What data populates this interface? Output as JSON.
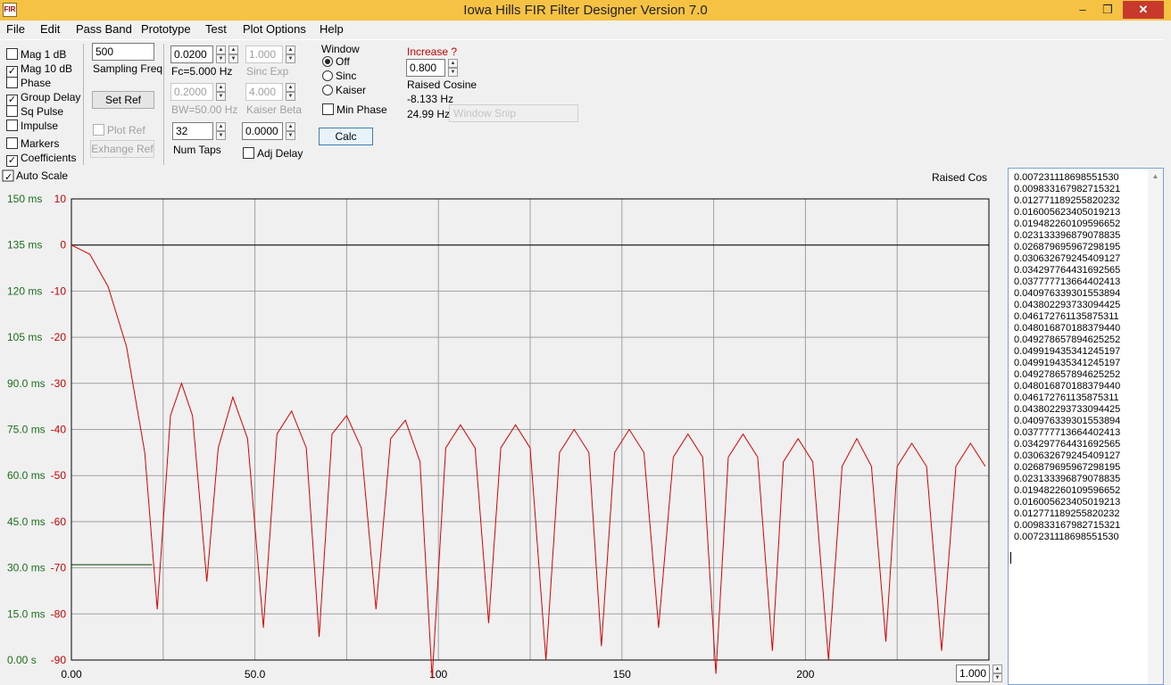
{
  "window": {
    "title": "Iowa Hills FIR Filter Designer  Version 7.0",
    "icon_text": "FIR",
    "min": "–",
    "max": "❐",
    "close": "✕"
  },
  "menu": [
    "File",
    "Edit",
    "Pass Band",
    "Prototype",
    "Test",
    "Plot Options",
    "Help"
  ],
  "plot_checks": {
    "mag1db": {
      "label": "Mag   1 dB",
      "checked": false
    },
    "mag10db": {
      "label": "Mag 10 dB",
      "checked": true
    },
    "phase": {
      "label": "Phase",
      "checked": false
    },
    "group_delay": {
      "label": "Group Delay",
      "checked": true
    },
    "sq_pulse": {
      "label": "Sq Pulse",
      "checked": false
    },
    "impulse": {
      "label": "Impulse",
      "checked": false
    },
    "markers": {
      "label": "Markers",
      "checked": false
    },
    "coefficients": {
      "label": "Coefficients",
      "checked": true
    }
  },
  "sampling": {
    "value": "500",
    "label": "Sampling Freq"
  },
  "set_ref": "Set Ref",
  "plot_ref": "Plot Ref",
  "exchange_ref": "Exhange Ref",
  "fc": {
    "value": "0.0200",
    "label": "Fc=5.000 Hz"
  },
  "bw": {
    "value": "0.2000",
    "label": "BW=50.00 Hz"
  },
  "num_taps": {
    "value": "32",
    "label": "Num Taps"
  },
  "sinc_exp": {
    "value": "1.000",
    "label": "Sinc Exp"
  },
  "kaiser_beta": {
    "value": "4.000",
    "label": "Kaiser Beta"
  },
  "adj_delay": {
    "value": "0.0000",
    "label": "Adj Delay"
  },
  "window_group": {
    "label": "Window",
    "options": [
      "Off",
      "Sinc",
      "Kaiser"
    ],
    "selected": "Off"
  },
  "min_phase": "Min Phase",
  "calc": "Calc",
  "increase": {
    "label": "Increase ?",
    "value": "0.800"
  },
  "prototype": {
    "name": "Raised Cosine",
    "line1": "-8.133 Hz",
    "line2": "24.99 Hz"
  },
  "window_snip": "Window Snip",
  "auto_scale": "Auto Scale",
  "plot_title": "Raised Cos",
  "zoom_value": "1.000",
  "colors": {
    "delay_axis": "#1a6e1a",
    "db_axis": "#cc0000",
    "magnitude": "#dd0000",
    "group_delay": "#004000",
    "grid": "#a0a0a0"
  },
  "chart_data": {
    "type": "line",
    "title": "Raised Cos",
    "x_ticks": [
      "0.00",
      "50.0",
      "100",
      "150",
      "200"
    ],
    "xlim": [
      0,
      250
    ],
    "y_left_label_ticks": [
      "150 ms",
      "135 ms",
      "120 ms",
      "105 ms",
      "90.0 ms",
      "75.0 ms",
      "60.0 ms",
      "45.0 ms",
      "30.0 ms",
      "15.0 ms",
      "0.00 s"
    ],
    "y_right_ticks": [
      "10",
      "0",
      "-10",
      "-20",
      "-30",
      "-40",
      "-50",
      "-60",
      "-70",
      "-80",
      "-90"
    ],
    "ylim_db": [
      -90,
      10
    ],
    "ylim_delay_ms": [
      0,
      150
    ],
    "grid": true,
    "series": [
      {
        "name": "Mag 10 dB",
        "description": "magnitude response",
        "x": [
          0,
          5,
          10,
          15,
          20,
          23.4,
          27,
          30,
          33,
          36.9,
          40,
          44,
          48,
          52.3,
          56,
          60,
          64,
          67.5,
          71,
          75,
          79,
          83.0,
          87,
          91,
          95,
          98.3,
          102,
          106,
          110,
          113.7,
          117,
          121,
          125,
          129.3,
          133,
          137,
          141,
          144.4,
          148,
          152,
          156,
          160.0,
          164,
          168,
          172,
          175.6,
          179,
          183,
          187,
          191.0,
          194,
          198,
          202,
          206.3,
          210,
          214,
          218,
          221.9,
          225,
          229,
          233,
          237.1,
          241,
          245,
          249
        ],
        "y": [
          0,
          -2,
          -9,
          -22,
          -45,
          -79,
          -37,
          -30,
          -37,
          -73,
          -44,
          -33,
          -42,
          -83,
          -41,
          -36,
          -44,
          -85,
          -41,
          -37,
          -44,
          -79,
          -42,
          -38,
          -47,
          -94,
          -44,
          -39,
          -44,
          -82,
          -44,
          -39,
          -44,
          -90,
          -45,
          -40,
          -45,
          -87,
          -45,
          -40,
          -45,
          -83,
          -46,
          -41,
          -46,
          -93,
          -46,
          -41,
          -46,
          -88,
          -47,
          -42,
          -47,
          -90,
          -48,
          -42,
          -48,
          -86,
          -48,
          -43,
          -48,
          -88,
          -48,
          -43,
          -48
        ]
      },
      {
        "name": "Group Delay",
        "description": "group delay",
        "x": [
          0,
          22
        ],
        "y_ms": [
          31,
          31
        ]
      }
    ]
  },
  "coefficients": [
    "0.007231118698551530",
    "0.009833167982715321",
    "0.012771189255820232",
    "0.016005623405019213",
    "0.019482260109596652",
    "0.023133396879078835",
    "0.026879695967298195",
    "0.030632679245409127",
    "0.034297764431692565",
    "0.037777713664402413",
    "0.040976339301553894",
    "0.043802293733094425",
    "0.046172761135875311",
    "0.048016870188379440",
    "0.049278657894625252",
    "0.049919435341245197",
    "0.049919435341245197",
    "0.049278657894625252",
    "0.048016870188379440",
    "0.046172761135875311",
    "0.043802293733094425",
    "0.040976339301553894",
    "0.037777713664402413",
    "0.034297764431692565",
    "0.030632679245409127",
    "0.026879695967298195",
    "0.023133396879078835",
    "0.019482260109596652",
    "0.016005623405019213",
    "0.012771189255820232",
    "0.009833167982715321",
    "0.007231118698551530"
  ]
}
